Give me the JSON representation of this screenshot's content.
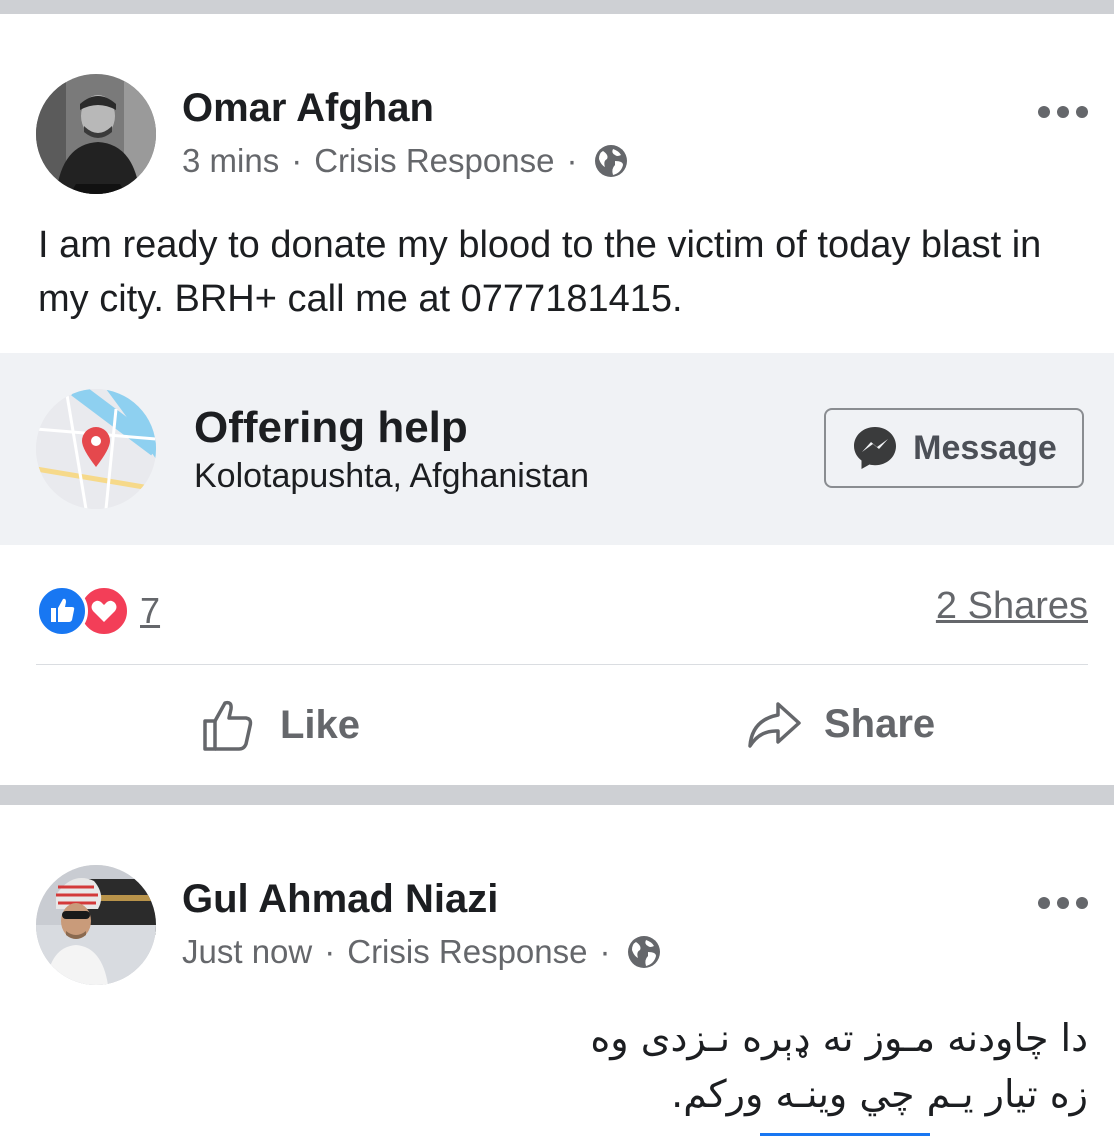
{
  "posts": [
    {
      "author": "Omar Afghan",
      "time": "3 mins",
      "group": "Crisis Response",
      "dot": "·",
      "audience_icon": "globe-icon",
      "body": "I am ready to donate my blood to the victim of today blast in my city. BRH+ call me at 0777181415.",
      "attachment": {
        "title": "Offering help",
        "location": "Kolotapushta, Afghanistan",
        "button_label": "Message"
      },
      "reaction_count": "7",
      "shares": "2 Shares",
      "actions": {
        "like": "Like",
        "share": "Share"
      }
    },
    {
      "author": "Gul Ahmad Niazi",
      "time": "Just now",
      "group": "Crisis Response",
      "dot": "·",
      "audience_icon": "globe-icon",
      "body_line1": "دا چاودنه مـوز ته ډېره نـزدی وه",
      "body_line2": "زه تيار يـم چي وينـه ورکم."
    }
  ],
  "colors": {
    "divider": "#ced0d4",
    "secondary_text": "#65676b",
    "like_blue": "#1877f2",
    "love_red": "#f33e58",
    "attachment_bg": "#f0f2f5"
  }
}
